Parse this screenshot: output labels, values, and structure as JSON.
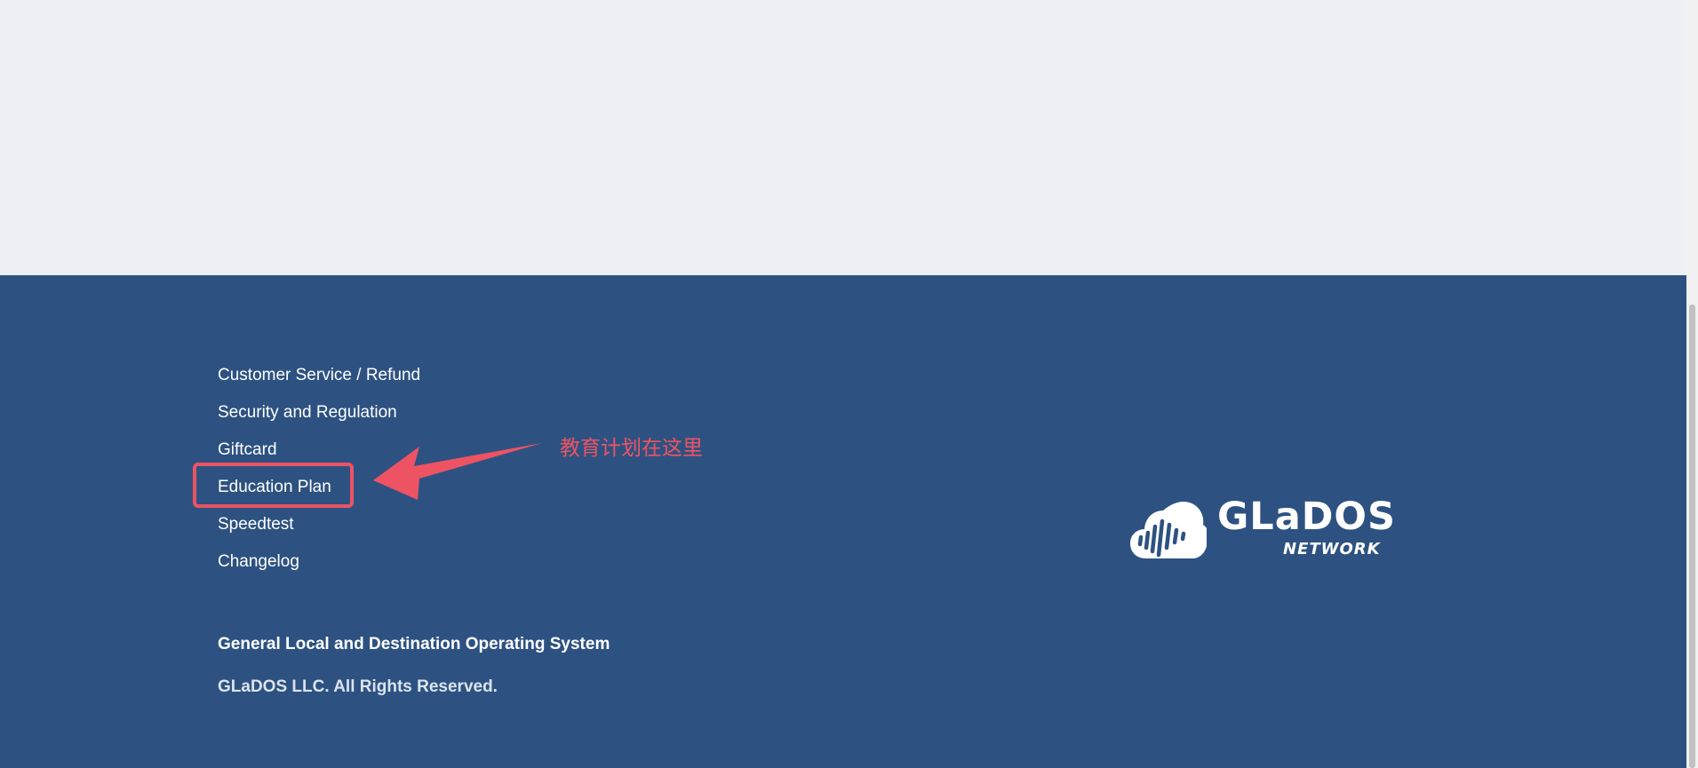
{
  "footer": {
    "links": [
      {
        "label": "Customer Service / Refund"
      },
      {
        "label": "Security and Regulation"
      },
      {
        "label": "Giftcard"
      },
      {
        "label": "Education Plan"
      },
      {
        "label": "Speedtest"
      },
      {
        "label": "Changelog"
      }
    ],
    "tagline": "General Local and Destination Operating System",
    "copyright": "GLaDOS LLC. All Rights Reserved."
  },
  "logo": {
    "name": "GLaDOS",
    "subtitle": "NETWORK",
    "icon": "cloud-soundwave-icon"
  },
  "annotation": {
    "text": "教育计划在这里",
    "target": "Education Plan",
    "color": "#ee5364"
  },
  "colors": {
    "top_background": "#edf1f5",
    "footer_background": "#2d5281",
    "text": "#ffffff"
  }
}
